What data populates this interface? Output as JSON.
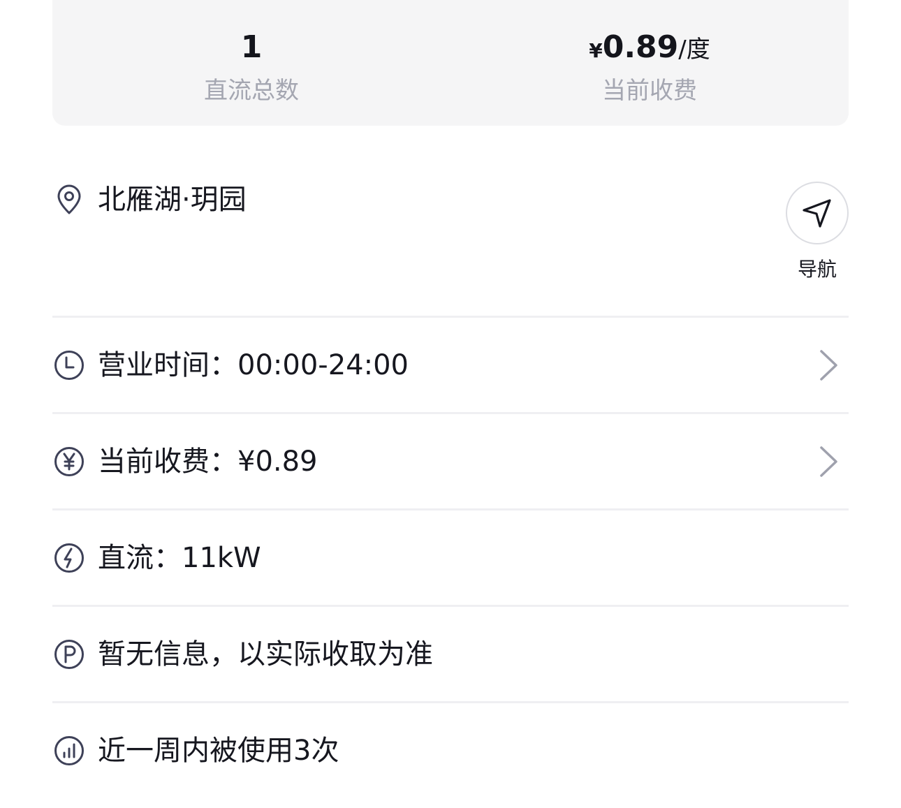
{
  "stats": {
    "dc_total_value": "1",
    "dc_total_label": "直流总数",
    "price_currency": "¥",
    "price_value": "0.89",
    "price_unit": "/度",
    "price_label": "当前收费"
  },
  "location": {
    "name": "北雁湖·玥园",
    "icon": "location-pin-icon",
    "nav_label": "导航",
    "nav_icon": "navigation-arrow-icon"
  },
  "rows": [
    {
      "icon": "clock-icon",
      "text": "营业时间：00:00-24:00",
      "has_chevron": true
    },
    {
      "icon": "yuan-icon",
      "text": "当前收费：¥0.89",
      "has_chevron": true
    },
    {
      "icon": "lightning-icon",
      "text": "直流：11kW",
      "has_chevron": false
    },
    {
      "icon": "parking-icon",
      "text": "暂无信息，以实际收取为准",
      "has_chevron": false
    },
    {
      "icon": "bar-chart-icon",
      "text": "近一周内被使用3次",
      "has_chevron": false
    }
  ],
  "colors": {
    "text_primary": "#16171f",
    "text_secondary": "#a4a6b1",
    "card_background": "#f5f5f6",
    "icon_stroke": "#3e4158",
    "divider": "#efeff2",
    "chevron": "#9fa1ad"
  }
}
